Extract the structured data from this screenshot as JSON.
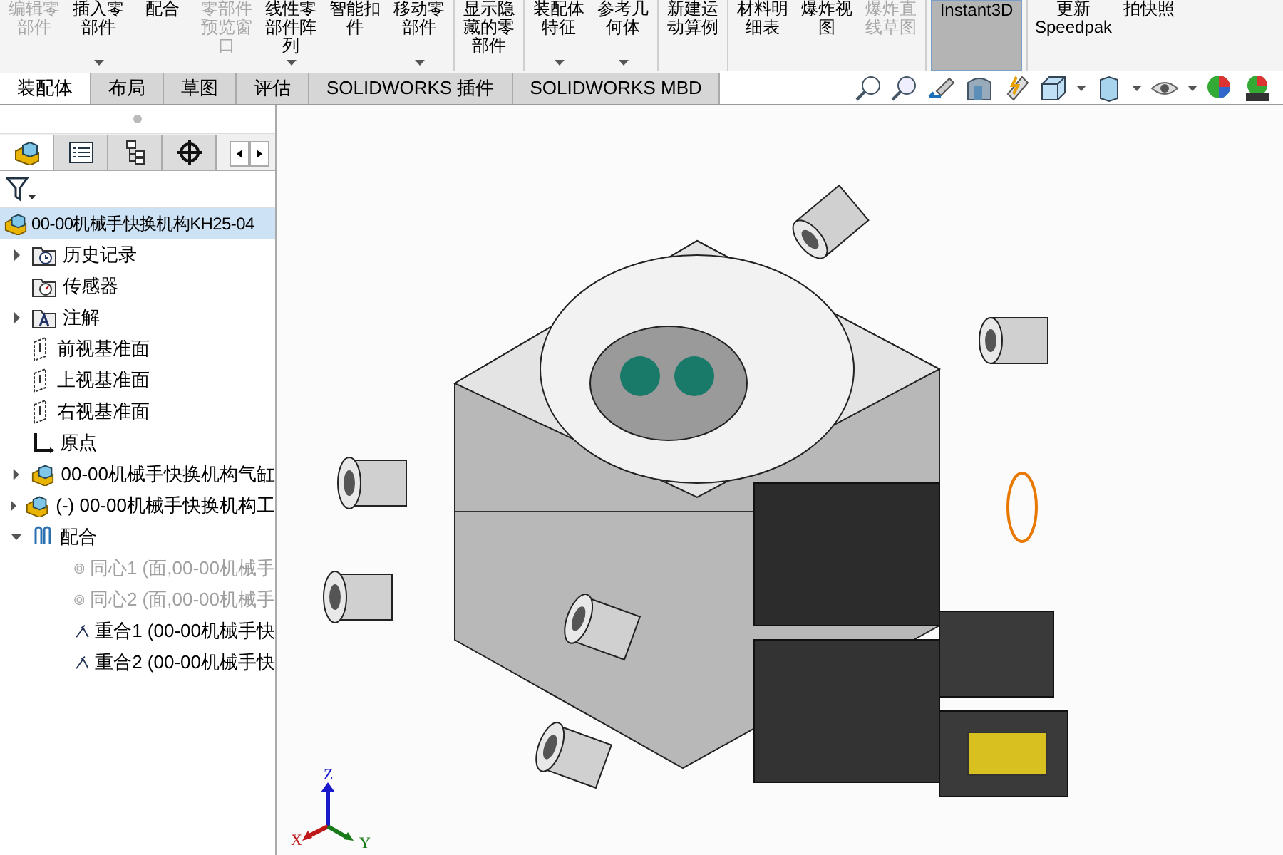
{
  "toolbar": {
    "groups": [
      {
        "buttons": [
          {
            "label": "编辑零部件",
            "disabled": true,
            "dropdown": false
          },
          {
            "label": "插入零部件",
            "disabled": false,
            "dropdown": true
          },
          {
            "label": "配合",
            "disabled": false,
            "dropdown": false
          },
          {
            "label": "零部件预览窗口",
            "disabled": true,
            "dropdown": false
          },
          {
            "label": "线性零部件阵列",
            "disabled": false,
            "dropdown": true
          },
          {
            "label": "智能扣件",
            "disabled": false,
            "dropdown": false
          },
          {
            "label": "移动零部件",
            "disabled": false,
            "dropdown": true
          }
        ]
      },
      {
        "buttons": [
          {
            "label": "显示隐藏的零部件",
            "disabled": false,
            "dropdown": false
          }
        ]
      },
      {
        "buttons": [
          {
            "label": "装配体特征",
            "disabled": false,
            "dropdown": true
          },
          {
            "label": "参考几何体",
            "disabled": false,
            "dropdown": true
          }
        ]
      },
      {
        "buttons": [
          {
            "label": "新建运动算例",
            "disabled": false,
            "dropdown": false
          }
        ]
      },
      {
        "buttons": [
          {
            "label": "材料明细表",
            "disabled": false,
            "dropdown": false
          },
          {
            "label": "爆炸视图",
            "disabled": false,
            "dropdown": false
          },
          {
            "label": "爆炸直线草图",
            "disabled": true,
            "dropdown": false
          }
        ]
      },
      {
        "buttons": [
          {
            "label": "Instant3D",
            "disabled": false,
            "dropdown": false,
            "selected": true
          }
        ]
      },
      {
        "buttons": [
          {
            "label": "更新 Speedpak",
            "disabled": false,
            "dropdown": false,
            "selected": false
          },
          {
            "label": "拍快照",
            "disabled": false,
            "dropdown": false,
            "selected": false
          }
        ]
      }
    ]
  },
  "tabs": [
    {
      "label": "装配体",
      "selected": true
    },
    {
      "label": "布局",
      "selected": false
    },
    {
      "label": "草图",
      "selected": false
    },
    {
      "label": "评估",
      "selected": false
    },
    {
      "label": "SOLIDWORKS 插件",
      "selected": false
    },
    {
      "label": "SOLIDWORKS MBD",
      "selected": false
    }
  ],
  "panel_tabs": [
    {
      "kind": "feature-tree",
      "selected": true
    },
    {
      "kind": "properties",
      "selected": false
    },
    {
      "kind": "configurations",
      "selected": false
    },
    {
      "kind": "dimxpert",
      "selected": false
    }
  ],
  "tree": {
    "label": "00-00机械手快换机构KH25-04",
    "selected": true,
    "children": [
      {
        "kind": "history",
        "label": "历史记录",
        "expanded": false,
        "suppressed": false
      },
      {
        "kind": "sensor",
        "label": "传感器",
        "suppressed": false
      },
      {
        "kind": "annotation",
        "label": "注解",
        "expanded": false,
        "suppressed": false
      },
      {
        "kind": "plane",
        "label": "前视基准面",
        "suppressed": false
      },
      {
        "kind": "plane",
        "label": "上视基准面",
        "suppressed": false
      },
      {
        "kind": "plane",
        "label": "右视基准面",
        "suppressed": false
      },
      {
        "kind": "origin",
        "label": "原点",
        "suppressed": false
      },
      {
        "kind": "part",
        "label": "00-00机械手快换机构气缸",
        "expanded": false,
        "suppressed": false
      },
      {
        "kind": "part",
        "label": "(-) 00-00机械手快换机构工",
        "expanded": false,
        "suppressed": false
      },
      {
        "kind": "mates",
        "label": "配合",
        "expanded": true,
        "suppressed": false,
        "children": [
          {
            "kind": "concentric",
            "label": "同心1 (面,00-00机械手",
            "suppressed": true
          },
          {
            "kind": "concentric",
            "label": "同心2 (面,00-00机械手",
            "suppressed": true
          },
          {
            "kind": "coincident",
            "label": "重合1 (00-00机械手快",
            "suppressed": false
          },
          {
            "kind": "coincident",
            "label": "重合2 (00-00机械手快",
            "suppressed": false
          }
        ]
      }
    ]
  },
  "triad": {
    "x": "X",
    "y": "Y",
    "z": "Z"
  }
}
